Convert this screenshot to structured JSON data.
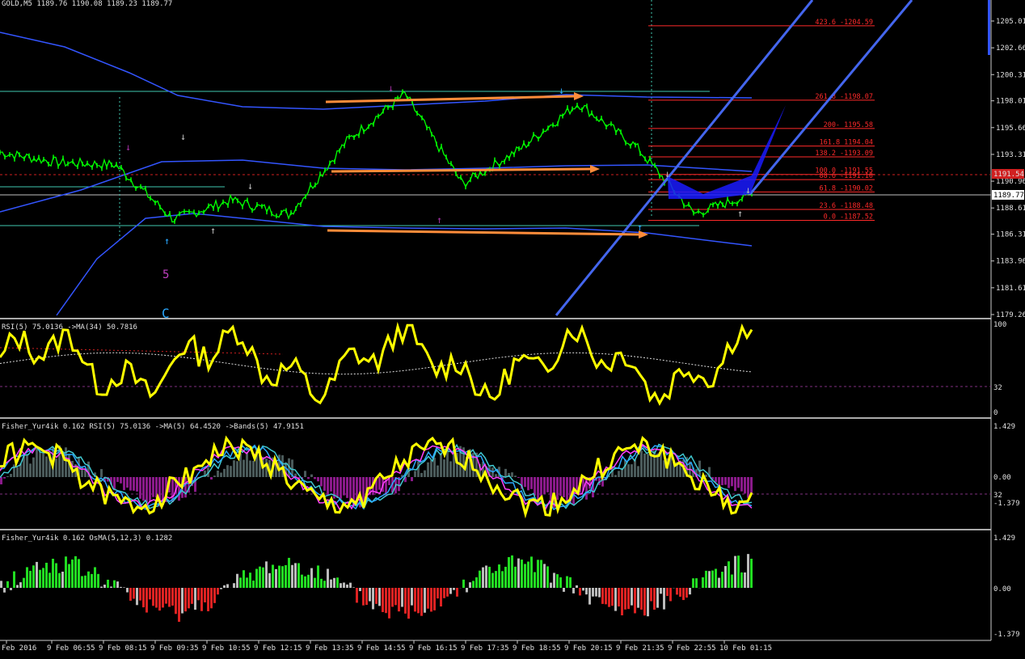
{
  "symbol_header": "GOLD,M5  1189.76 1190.08 1189.23 1189.77",
  "colors": {
    "background": "#000000",
    "price": "#00ff00",
    "bands": "#3355ff",
    "fib": "#ff2a2a",
    "arrows_orange": "#ff8c3a",
    "channel": "#4466ee",
    "rsi": "#ffff00",
    "osma_up": "#22dd22",
    "osma_down": "#dd2222",
    "osma_neutral": "#bbbbbb"
  },
  "price_axis": {
    "labels": [
      "1205.01",
      "1202.66",
      "1200.31",
      "1198.01",
      "1195.66",
      "1193.31",
      "1190.96",
      "1188.61",
      "1186.31",
      "1183.96",
      "1181.61",
      "1179.26"
    ],
    "values": [
      1205.01,
      1202.66,
      1200.31,
      1198.01,
      1195.66,
      1193.31,
      1190.96,
      1188.61,
      1186.31,
      1183.96,
      1181.61,
      1179.26
    ],
    "current": "1189.77",
    "red_level": "1191.54"
  },
  "fib_levels": [
    {
      "label": "423.6 -1204.59",
      "value": 1204.59
    },
    {
      "label": "261.8 -1198.07",
      "value": 1198.07
    },
    {
      "label": "200- 1195.58",
      "value": 1195.58
    },
    {
      "label": "161.8 1194.04",
      "value": 1194.04
    },
    {
      "label": "138.2 -1193.09",
      "value": 1193.09
    },
    {
      "label": "100.0 -1191.55",
      "value": 1191.55
    },
    {
      "label": "88.6 -1191.10",
      "value": 1191.1
    },
    {
      "label": "61.8 -1190.02",
      "value": 1190.02
    },
    {
      "label": "23.6 -1188.48",
      "value": 1188.48
    },
    {
      "label": "0.0 -1187.52",
      "value": 1187.52
    }
  ],
  "wave_labels": [
    "5",
    "C"
  ],
  "rsi_panel": {
    "header": "RSI(5) 75.0136  ->MA(34) 50.7816",
    "axis": [
      "100",
      "32",
      "0"
    ]
  },
  "fisher_panel": {
    "header": "Fisher_Yur4ik 0.162  RSI(5) 75.0136  ->MA(5) 64.4520  ->Bands(5) 47.9151",
    "axis": [
      "1.429",
      "0.00",
      "32",
      "-1.379"
    ]
  },
  "osma_panel": {
    "header": "Fisher_Yur4ik 0.162  OsMA(5,12,3) 0.1282",
    "axis": [
      "1.429",
      "0.00",
      "-1.379"
    ]
  },
  "time_axis": [
    "Feb 2016",
    "9 Feb 06:55",
    "9 Feb 08:15",
    "9 Feb 09:35",
    "9 Feb 10:55",
    "9 Feb 12:15",
    "9 Feb 13:35",
    "9 Feb 14:55",
    "9 Feb 16:15",
    "9 Feb 17:35",
    "9 Feb 18:55",
    "9 Feb 20:15",
    "9 Feb 21:35",
    "9 Feb 22:55",
    "10 Feb 01:15"
  ],
  "chart_data": {
    "type": "line",
    "title": "GOLD,M5",
    "ylim": [
      1179.26,
      1206.0
    ],
    "x": [
      "9 Feb 06:55",
      "9 Feb 08:15",
      "9 Feb 09:35",
      "9 Feb 10:55",
      "9 Feb 12:15",
      "9 Feb 13:35",
      "9 Feb 14:55",
      "9 Feb 16:15",
      "9 Feb 17:35",
      "9 Feb 18:55",
      "9 Feb 20:15",
      "9 Feb 21:35",
      "9 Feb 22:55",
      "10 Feb 01:15"
    ],
    "series": [
      {
        "values": [
          1193.5,
          1192.6,
          1192.4,
          1187.6,
          1189.3,
          1188.0,
          1194.5,
          1198.6,
          1190.7,
          1193.8,
          1197.8,
          1194.0,
          1188.1,
          1189.8
        ]
      }
    ]
  }
}
